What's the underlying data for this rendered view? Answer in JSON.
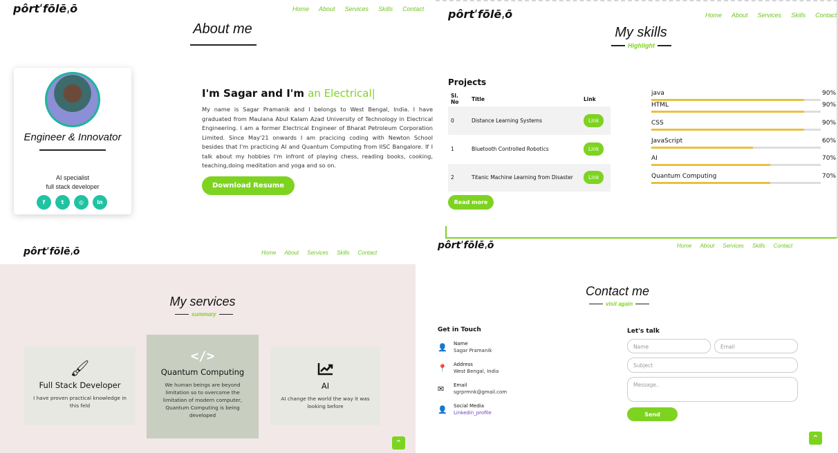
{
  "logo": "pôrtˈfōlēˌō",
  "nav": [
    "Home",
    "About",
    "Services",
    "Skills",
    "Contact"
  ],
  "about": {
    "heading": "About me",
    "card_title": "Engineer & Innovator",
    "roles": [
      "AI specialist",
      "full stack developer"
    ],
    "socials": [
      "facebook-icon",
      "twitter-icon",
      "instagram-icon",
      "linkedin-icon"
    ],
    "intro_prefix": "I'm Sagar and I'm",
    "intro_highlight": "an Electrical",
    "bio": "My name is Sagar Pramanik and I belongs to West Bengal, India. I have graduated from Maulana Abul Kalam Azad University of Technology in Electrical Engineering. I am a former Electrical Engineer of Bharat Petroleum Corporation Limited. Since May'21 onwards I am pracicing coding with Newton School besides that I'm practicing AI and Quantum Computing from IISC Bangalore. If I talk about my hobbies I'm infront of playing chess, reading books, cooking, teaching,doing meditation and yoga and so on.",
    "download_label": "Download Resume"
  },
  "skills": {
    "heading": "My skills",
    "subheading": "Highlight",
    "projects_title": "Projects",
    "columns": [
      "Sl. No",
      "Title",
      "Link"
    ],
    "rows": [
      {
        "no": "0",
        "title": "Distance Learning Systems",
        "link": "Link"
      },
      {
        "no": "1",
        "title": "Bluetooth Controlled Robotics",
        "link": "Link"
      },
      {
        "no": "2",
        "title": "Titanic Machine Learning from Disaster",
        "link": "Link"
      }
    ],
    "read_more": "Read more",
    "items": [
      {
        "name": "java",
        "pct": "90%",
        "level": 0.9
      },
      {
        "name": "HTML",
        "pct": "90%",
        "level": 0.9
      },
      {
        "name": "CSS",
        "pct": "90%",
        "level": 0.9
      },
      {
        "name": "JavaScript",
        "pct": "60%",
        "level": 0.6
      },
      {
        "name": "AI",
        "pct": "70%",
        "level": 0.7
      },
      {
        "name": "Quantum Computing",
        "pct": "70%",
        "level": 0.7
      }
    ]
  },
  "services": {
    "heading": "My services",
    "subheading": "summary",
    "cards": [
      {
        "icon": "brush-icon",
        "title": "Full Stack Developer",
        "desc": "I have proven practical knowledge in this feld"
      },
      {
        "icon": "code-icon",
        "title": "Quantum Computing",
        "desc": "We human beings are beyond limitation so to overcome the limitation of modern computer, Quantum Computing is being developed"
      },
      {
        "icon": "chart-line-icon",
        "title": "AI",
        "desc": "AI change the world the way it was looking before"
      }
    ]
  },
  "contact": {
    "heading": "Contact me",
    "subheading": "visit again",
    "get_in_touch": "Get in Touch",
    "items": [
      {
        "icon": "user-icon",
        "label": "Name",
        "value": "Sagar Pramanik"
      },
      {
        "icon": "map-pin-icon",
        "label": "Address",
        "value": "West Bengal, India"
      },
      {
        "icon": "envelope-icon",
        "label": "Email",
        "value": "sgrprmnk@gmail.com"
      },
      {
        "icon": "user-icon",
        "label": "Social Media",
        "value": "Linkedin_profile"
      }
    ],
    "lets_talk": "Let's talk",
    "name_ph": "Name",
    "email_ph": "Email",
    "subject_ph": "Subject",
    "message_ph": "Message..",
    "send_label": "Send"
  },
  "colors": {
    "accent": "#7ed321",
    "social": "#1fc3a2",
    "bar": "#e8c040"
  }
}
